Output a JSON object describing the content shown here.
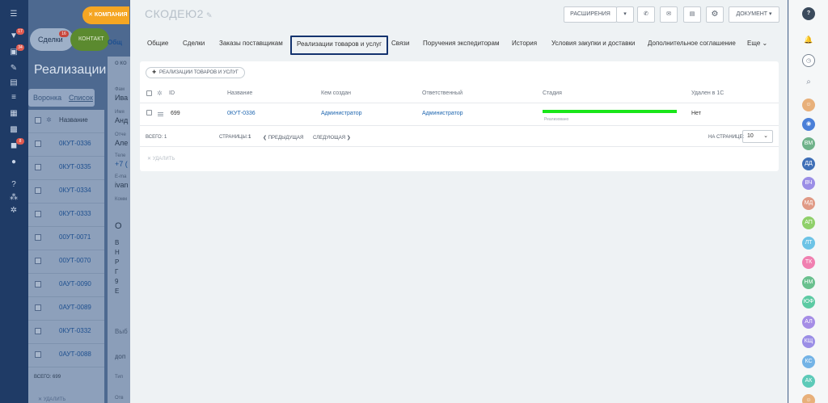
{
  "left_nav": {
    "badges": [
      "17",
      "34",
      "8"
    ]
  },
  "background": {
    "tabs": [
      "Сделки",
      "КОНТАКТ"
    ],
    "tabs_badge": "16",
    "company_button": "КОМПАНИЯ",
    "title": "Реализации то",
    "view_modes": [
      "Воронка",
      "Список"
    ],
    "list_header": "Название",
    "list_items": [
      "0КУТ-0336",
      "0КУТ-0335",
      "0КУТ-0334",
      "0КУТ-0333",
      "00УТ-0071",
      "00УТ-0070",
      "0АУТ-0090",
      "0АУТ-0089",
      "0КУТ-0332",
      "0АУТ-0088"
    ],
    "list_total": "ВСЕГО: 699",
    "list_delete": "УДАЛИТЬ",
    "detail_fragments": [
      "Общ",
      "О КО",
      "Фам",
      "Ива",
      "Имя",
      "Анд",
      "Отче",
      "Але",
      "Теле",
      "+7 (",
      "E-ma",
      "ivan",
      "Комм",
      "О",
      "В",
      "Н",
      "Р",
      "Г",
      "9",
      "Е",
      "Выб",
      "ДОП",
      "Тип",
      "Отв"
    ]
  },
  "panel": {
    "entity_title": "СКОДЕЮ2",
    "toolbar": {
      "extensions_label": "РАСШИРЕНИЯ",
      "document_label": "ДОКУМЕНТ"
    },
    "tabs": [
      {
        "label": "Общие",
        "active": false
      },
      {
        "label": "Сделки",
        "active": false
      },
      {
        "label": "Заказы поставщикам",
        "active": false
      },
      {
        "label": "Реализации товаров и услуг",
        "active": true
      },
      {
        "label": "Связи",
        "active": false
      },
      {
        "label": "Поручения экспедиторам",
        "active": false
      },
      {
        "label": "История",
        "active": false
      },
      {
        "label": "Условия закупки и доставки",
        "active": false
      },
      {
        "label": "Дополнительное соглашение",
        "active": false
      },
      {
        "label": "Еще",
        "active": false
      }
    ],
    "add_button_label": "РЕАЛИЗАЦИИ ТОВАРОВ И УСЛУГ",
    "grid": {
      "columns": [
        "ID",
        "Название",
        "Кем создан",
        "Ответственный",
        "Стадия",
        "Удален в 1С"
      ],
      "rows": [
        {
          "id": "699",
          "name": "0КУТ-0336",
          "created_by": "Администратор",
          "responsible": "Администратор",
          "stage": "Реализовано",
          "deleted_1c": "Нет"
        }
      ],
      "stage_color": "#19e619"
    },
    "footer": {
      "total": "ВСЕГО: 1",
      "pages_label": "СТРАНИЦЫ:",
      "current_page": "1",
      "prev": "ПРЕДЫДУЩАЯ",
      "next": "СЛЕДУЮЩАЯ",
      "per_page_label": "НА СТРАНИЦЕ:",
      "per_page_value": "10"
    },
    "delete_label": "УДАЛИТЬ"
  },
  "right_bar": {
    "avatars": [
      {
        "initials": "ВМ",
        "color": "#6fb28a"
      },
      {
        "initials": "ДД",
        "color": "#3f6fb7"
      },
      {
        "initials": "ВЧ",
        "color": "#9b8ee6"
      },
      {
        "initials": "МД",
        "color": "#e09a86"
      },
      {
        "initials": "АП",
        "color": "#8fd06a"
      },
      {
        "initials": "ЛТ",
        "color": "#6cc3e6"
      },
      {
        "initials": "ТК",
        "color": "#f07fb0"
      },
      {
        "initials": "НМ",
        "color": "#69c08e"
      },
      {
        "initials": "ЮФ",
        "color": "#5ccaa3"
      },
      {
        "initials": "АЛ",
        "color": "#a58de6"
      },
      {
        "initials": "КЩ",
        "color": "#9b8ee6"
      },
      {
        "initials": "КС",
        "color": "#73b3e6"
      },
      {
        "initials": "АК",
        "color": "#5ccab8"
      }
    ]
  }
}
